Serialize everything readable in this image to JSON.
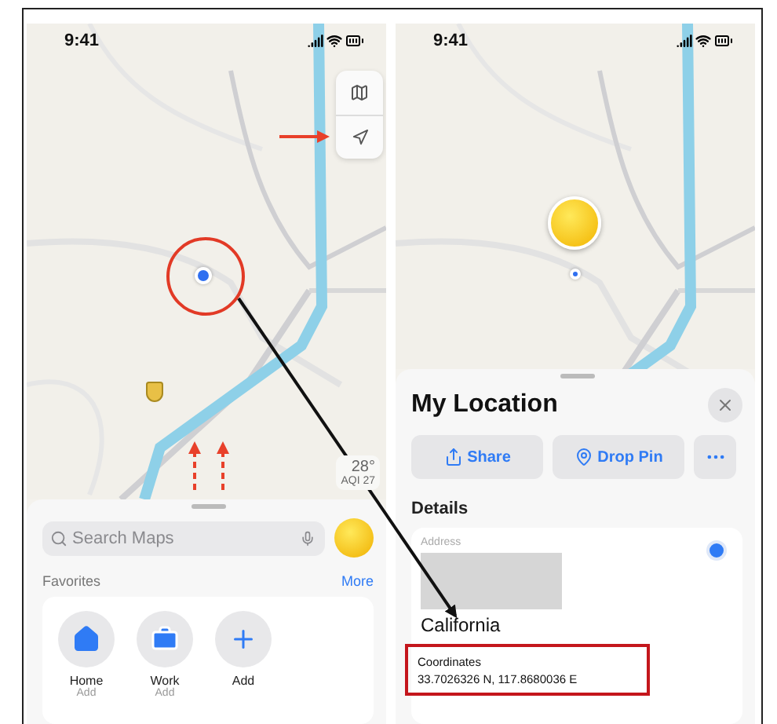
{
  "left_phone": {
    "status_bar": {
      "time": "9:41"
    },
    "weather": {
      "temperature": "28°",
      "aqi": "AQI 27"
    },
    "search": {
      "placeholder": "Search Maps"
    },
    "favorites": {
      "title": "Favorites",
      "more": "More",
      "items": [
        {
          "kind": "home",
          "label": "Home",
          "sublabel": "Add"
        },
        {
          "kind": "work",
          "label": "Work",
          "sublabel": "Add"
        },
        {
          "kind": "add",
          "label": "Add"
        }
      ]
    }
  },
  "right_phone": {
    "status_bar": {
      "time": "9:41"
    },
    "sheet": {
      "title": "My Location",
      "actions": [
        {
          "kind": "share",
          "label": "Share"
        },
        {
          "kind": "drop_pin",
          "label": "Drop Pin"
        },
        {
          "kind": "more"
        }
      ],
      "details": {
        "title": "Details",
        "address_label": "Address",
        "address_line": "California",
        "coordinates_label": "Coordinates",
        "coordinates": "33.7026326 N, 117.8680036 E"
      }
    }
  }
}
